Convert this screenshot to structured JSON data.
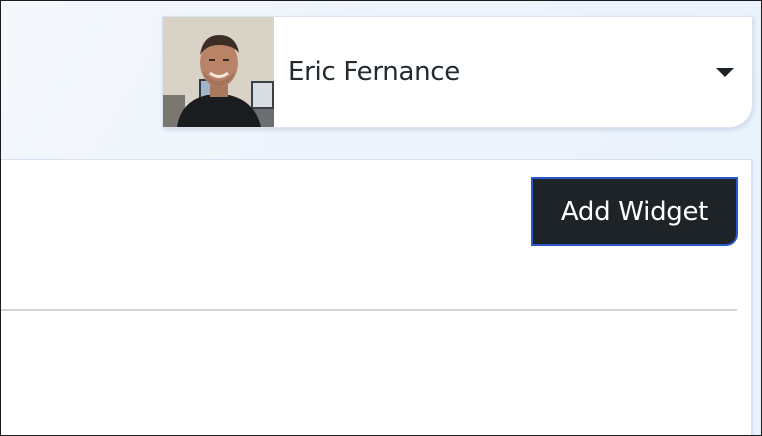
{
  "user_menu": {
    "name": "Eric Fernance",
    "avatar_icon": "user-photo",
    "dropdown_icon": "caret-down-icon"
  },
  "panel": {
    "add_widget_label": "Add Widget"
  },
  "colors": {
    "button_bg": "#1e2327",
    "button_border": "#2b57c9",
    "page_bg": "#eef4fc"
  }
}
